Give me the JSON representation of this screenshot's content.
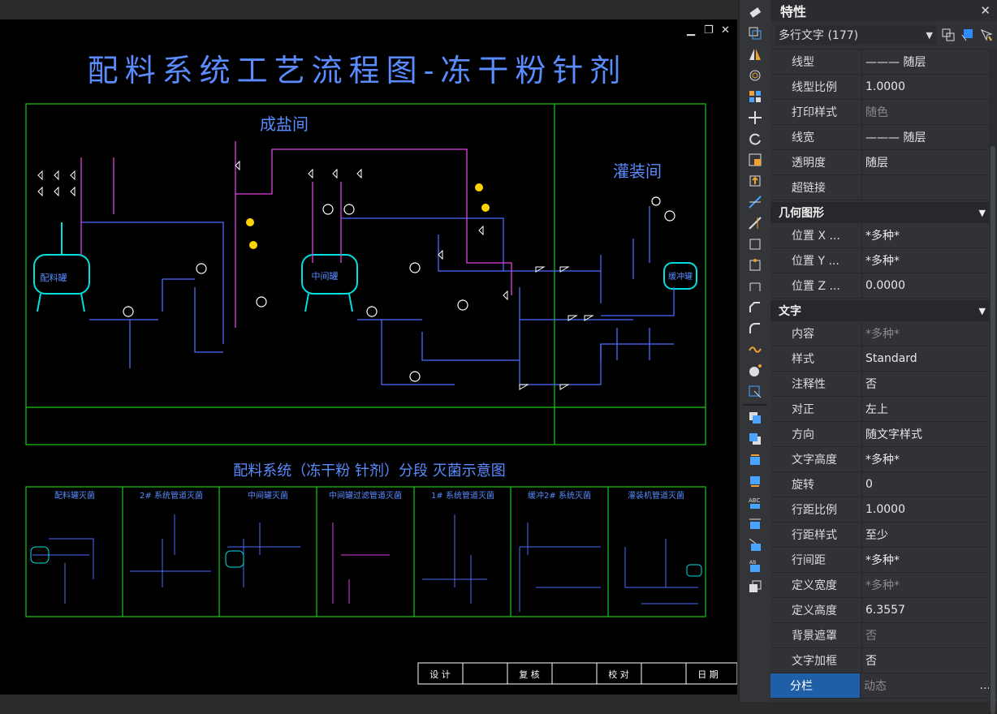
{
  "drawing": {
    "title": "配料系统工艺流程图-冻干粉针剂",
    "room_left": "成盐间",
    "room_right": "灌装间",
    "tank1": "配料罐",
    "tank2": "中间罐",
    "tank3": "缓冲罐",
    "subtitle": "配料系统（冻干粉  针剂）分段  灭菌示意图",
    "sub_panels": [
      "配料罐灭菌",
      "2# 系统管道灭菌",
      "中间罐灭菌",
      "中间罐过滤管道灭菌",
      "1# 系统管道灭菌",
      "缓冲2# 系统灭菌",
      "灌装机管道灭菌"
    ],
    "titleblock": [
      "设 计",
      "复 核",
      "校 对",
      "日 期"
    ]
  },
  "window_controls": {
    "minimize": "▁",
    "restore": "❐",
    "close": "✕"
  },
  "panel": {
    "title": "特性",
    "close": "✕",
    "selection": "多行文字 (177)",
    "section_general_rows": [
      {
        "k": "线型",
        "v": "——— 随层"
      },
      {
        "k": "线型比例",
        "v": "1.0000"
      },
      {
        "k": "打印样式",
        "v": "随色",
        "dim": true
      },
      {
        "k": "线宽",
        "v": "——— 随层"
      },
      {
        "k": "透明度",
        "v": "随层"
      },
      {
        "k": "超链接",
        "v": ""
      }
    ],
    "section_geometry": "几何图形",
    "geometry_rows": [
      {
        "k": "位置 X ...",
        "v": "*多种*"
      },
      {
        "k": "位置 Y ...",
        "v": "*多种*"
      },
      {
        "k": "位置 Z ...",
        "v": "0.0000"
      }
    ],
    "section_text": "文字",
    "text_rows": [
      {
        "k": "内容",
        "v": "*多种*",
        "dim": true
      },
      {
        "k": "样式",
        "v": "Standard"
      },
      {
        "k": "注释性",
        "v": "否"
      },
      {
        "k": "对正",
        "v": "左上"
      },
      {
        "k": "方向",
        "v": "随文字样式"
      },
      {
        "k": "文字高度",
        "v": "*多种*"
      },
      {
        "k": "旋转",
        "v": "0"
      },
      {
        "k": "行距比例",
        "v": "1.0000"
      },
      {
        "k": "行距样式",
        "v": "至少"
      },
      {
        "k": "行间距",
        "v": "*多种*"
      },
      {
        "k": "定义宽度",
        "v": "*多种*",
        "dim": true
      },
      {
        "k": "定义高度",
        "v": "6.3557"
      },
      {
        "k": "背景遮罩",
        "v": "否",
        "dim": true
      },
      {
        "k": "文字加框",
        "v": "否"
      },
      {
        "k": "分栏",
        "v": "动态",
        "dim": true,
        "hl": true,
        "extra": "..."
      }
    ]
  }
}
